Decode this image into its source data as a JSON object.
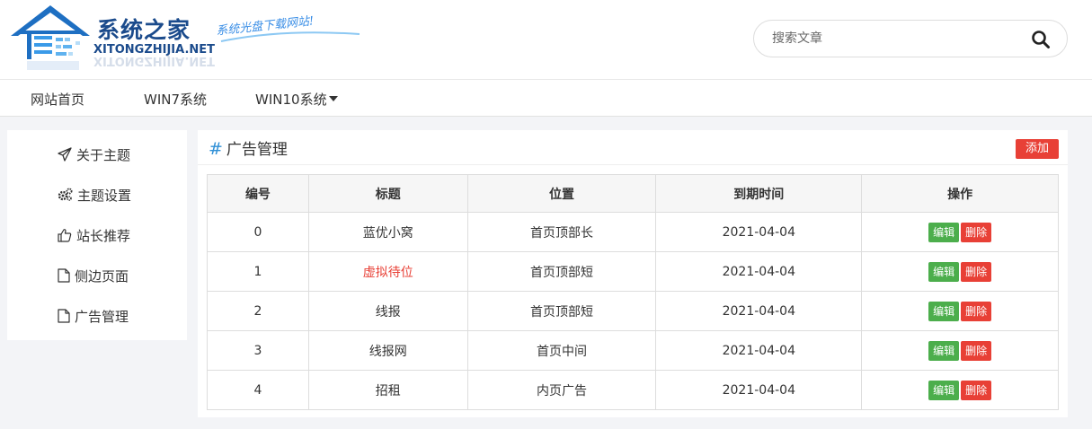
{
  "brand": {
    "name_cn": "系统之家",
    "name_en": "XITONGZHIJIA.NET",
    "slogan": "系统光盘下载网站!"
  },
  "search": {
    "placeholder": "搜索文章",
    "icon": "search-icon"
  },
  "nav": {
    "items": [
      {
        "label": "网站首页"
      },
      {
        "label": "WIN7系统"
      },
      {
        "label": "WIN10系统",
        "dropdown": true
      }
    ]
  },
  "sidebar": {
    "items": [
      {
        "label": "关于主题",
        "icon": "paper-plane-icon"
      },
      {
        "label": "主题设置",
        "icon": "gears-icon"
      },
      {
        "label": "站长推荐",
        "icon": "thumbs-up-icon"
      },
      {
        "label": "侧边页面",
        "icon": "file-icon"
      },
      {
        "label": "广告管理",
        "icon": "file-icon"
      }
    ]
  },
  "main": {
    "hash": "#",
    "title": "广告管理",
    "add_label": "添加",
    "columns": [
      "编号",
      "标题",
      "位置",
      "到期时间",
      "操作"
    ],
    "rows": [
      {
        "id": "0",
        "title": "蓝优小窝",
        "position": "首页顶部长",
        "expire": "2021-04-04",
        "title_highlight": false
      },
      {
        "id": "1",
        "title": "虚拟待位",
        "position": "首页顶部短",
        "expire": "2021-04-04",
        "title_highlight": true
      },
      {
        "id": "2",
        "title": "线报",
        "position": "首页顶部短",
        "expire": "2021-04-04",
        "title_highlight": false
      },
      {
        "id": "3",
        "title": "线报网",
        "position": "首页中间",
        "expire": "2021-04-04",
        "title_highlight": false
      },
      {
        "id": "4",
        "title": "招租",
        "position": "内页广告",
        "expire": "2021-04-04",
        "title_highlight": false
      }
    ],
    "edit_label": "编辑",
    "delete_label": "删除"
  },
  "colors": {
    "accent_blue": "#2e8fd6",
    "danger_red": "#e84036",
    "success_green": "#4cae4c",
    "brand_navy": "#1b4b8c"
  }
}
